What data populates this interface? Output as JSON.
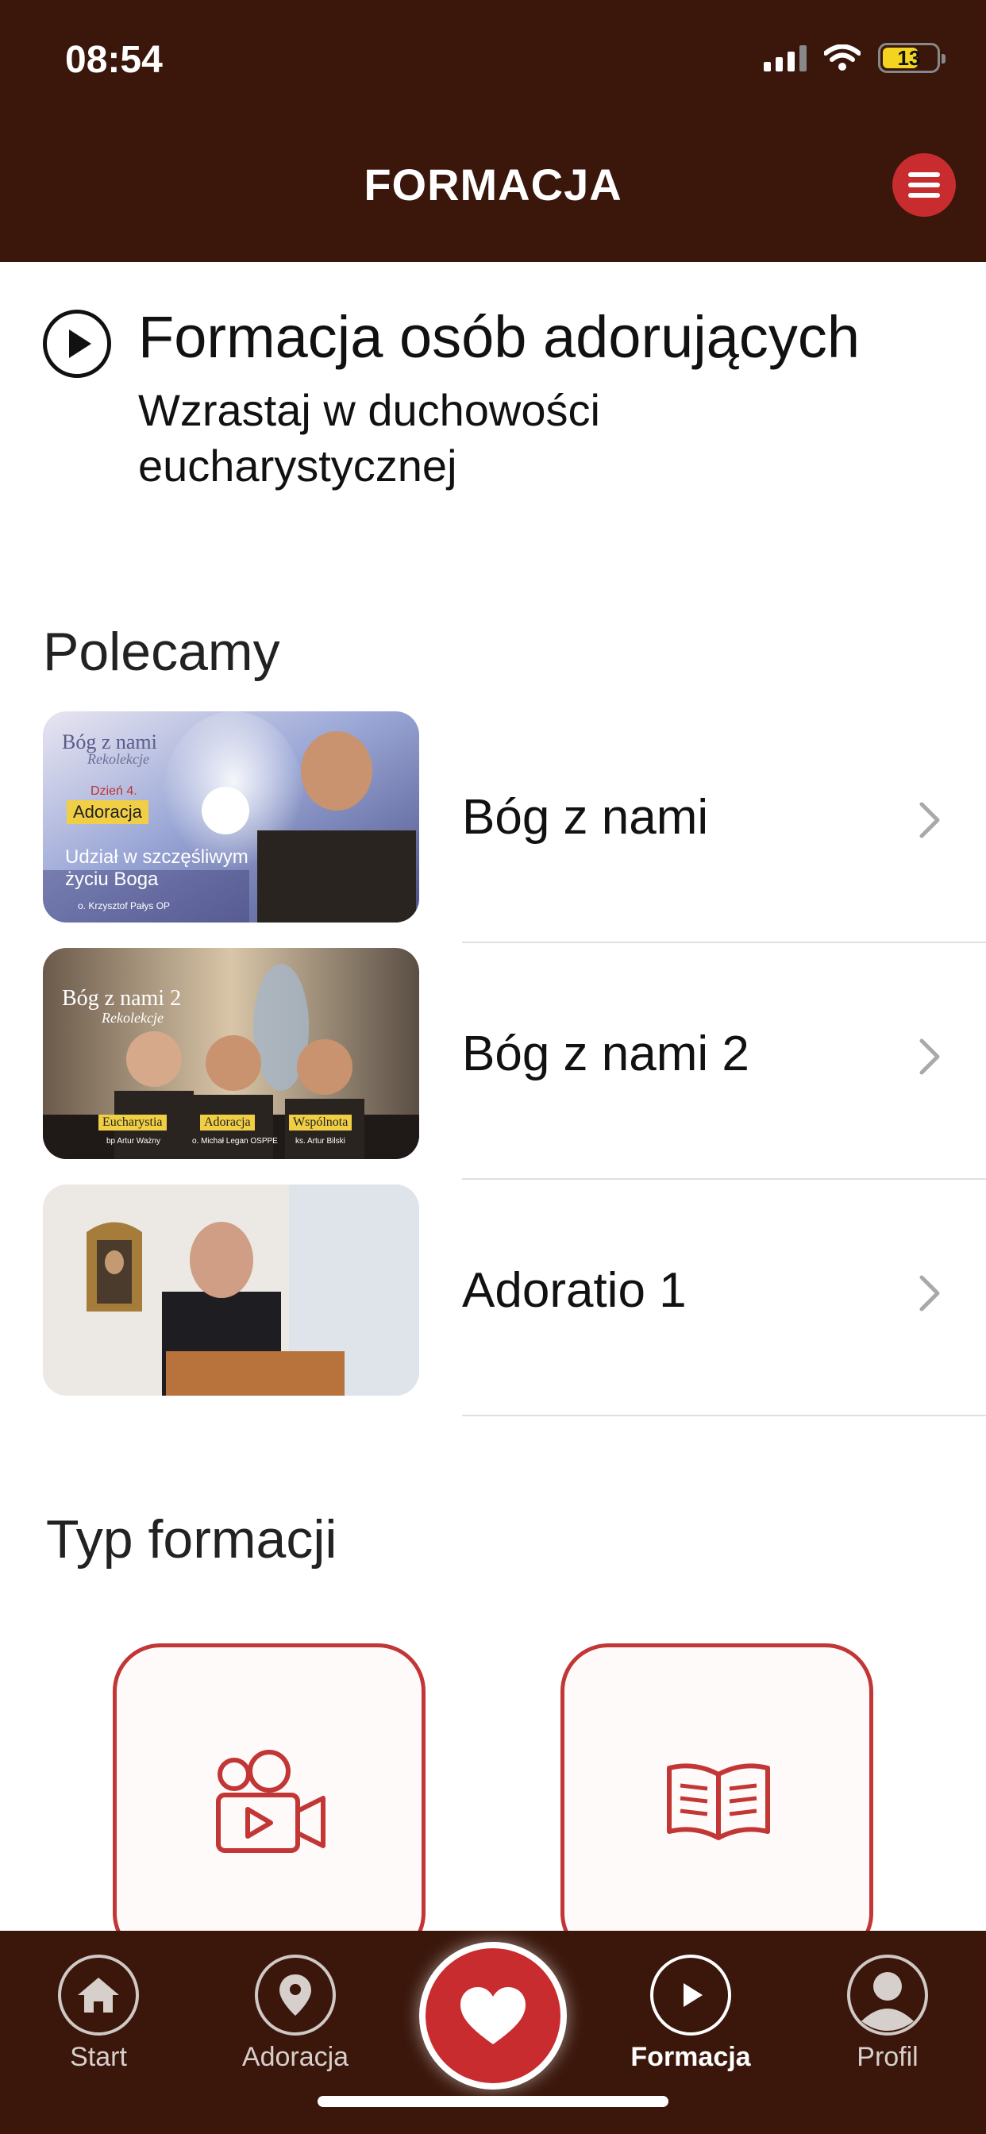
{
  "status_bar": {
    "time": "08:54",
    "battery": "13"
  },
  "header": {
    "title": "FORMACJA"
  },
  "hero": {
    "title": "Formacja osób adorujących",
    "subtitle": "Wzrastaj w duchowości eucharystycznej"
  },
  "recommended": {
    "title": "Polecamy",
    "items": [
      {
        "label": "Bóg z nami",
        "thumb": {
          "series": "Bóg z nami",
          "series_sub": "Rekolekcje",
          "day": "Dzień 4.",
          "badge": "Adoracja",
          "caption_line1": "Udział w szczęśliwym",
          "caption_line2": "życiu Boga",
          "author": "o. Krzysztof Pałys OP"
        }
      },
      {
        "label": "Bóg z nami 2",
        "thumb": {
          "series": "Bóg z nami 2",
          "series_sub": "Rekolekcje",
          "topics": [
            "Eucharystia",
            "Adoracja",
            "Wspólnota"
          ],
          "people": [
            "bp Artur Ważny",
            "o. Michał Legan OSPPE",
            "ks. Artur Bilski"
          ]
        }
      },
      {
        "label": "Adoratio 1",
        "thumb": {}
      }
    ]
  },
  "formation_types": {
    "title": "Typ formacji"
  },
  "tabbar": {
    "tabs": [
      {
        "label": "Start",
        "icon": "home-icon"
      },
      {
        "label": "Adoracja",
        "icon": "location-pin-icon"
      },
      {
        "label": "Formacja",
        "icon": "play-icon"
      },
      {
        "label": "Profil",
        "icon": "user-icon"
      }
    ]
  },
  "colors": {
    "header_bg": "#3a160b",
    "accent_red": "#c82c2f",
    "card_border": "#c23636"
  }
}
